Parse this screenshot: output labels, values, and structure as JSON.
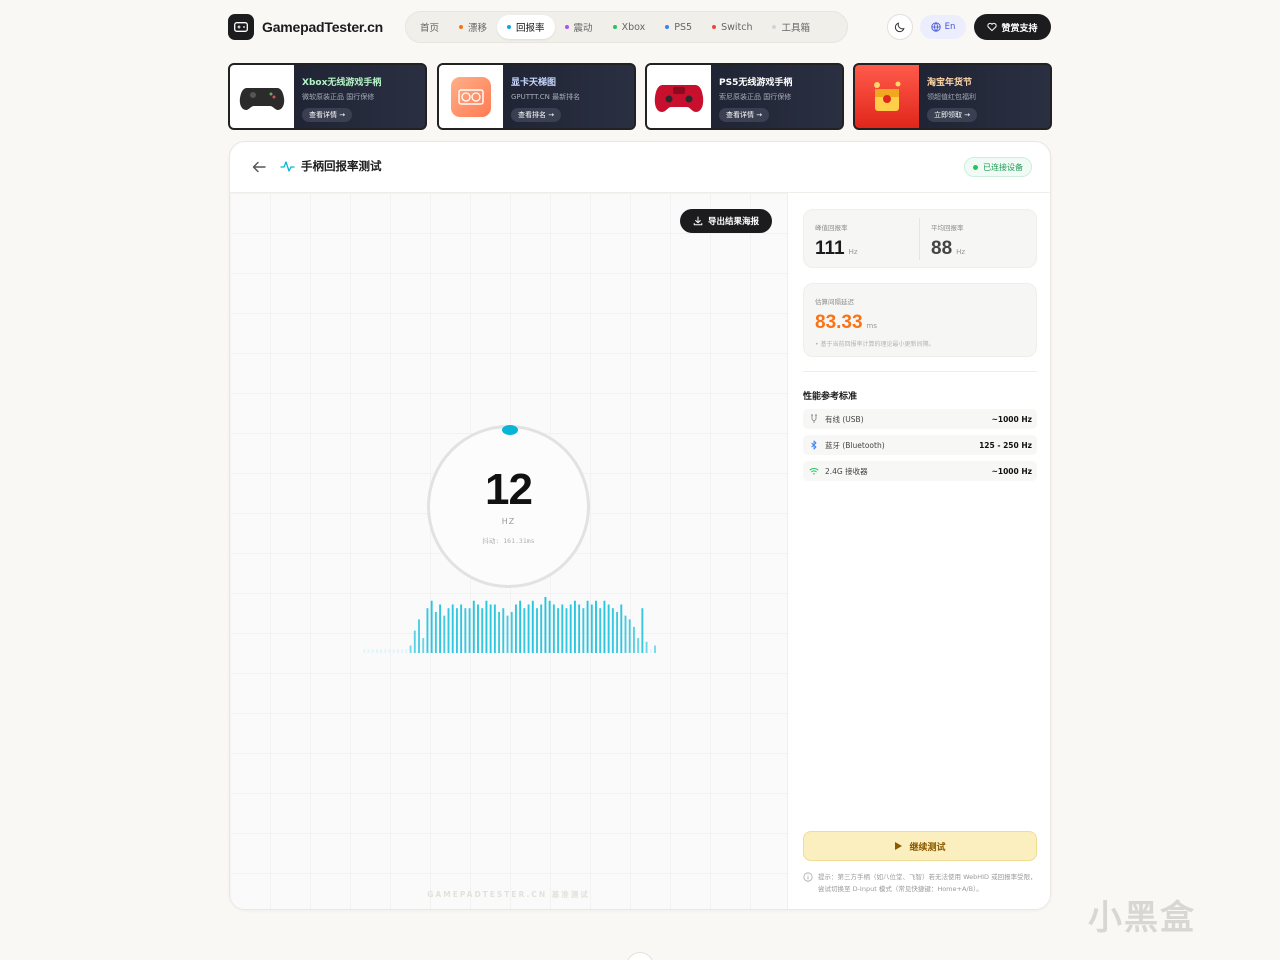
{
  "brand": {
    "name": "GamepadTester.cn"
  },
  "nav": {
    "items": [
      {
        "label": "首页",
        "dot": ""
      },
      {
        "label": "漂移",
        "dot": "#f97316"
      },
      {
        "label": "回报率",
        "dot": "#0ea5e9",
        "active": true
      },
      {
        "label": "震动",
        "dot": "#a855f7"
      },
      {
        "label": "Xbox",
        "dot": "#22c55e"
      },
      {
        "label": "PS5",
        "dot": "#3b82f6"
      },
      {
        "label": "Switch",
        "dot": "#ef4444"
      },
      {
        "label": "工具箱",
        "dot": "#cbd5e1"
      }
    ]
  },
  "header": {
    "lang_label": "En",
    "support_label": "赞赏支持"
  },
  "banners": [
    {
      "title": "Xbox无线游戏手柄",
      "subtitle": "微软原装正品 国行保修",
      "cta": "查看详情 →",
      "title_color": "#b6f5c8"
    },
    {
      "title": "显卡天梯图",
      "subtitle": "GPUTTT.CN 最新排名",
      "cta": "查看排名 →",
      "title_color": "#c9d8ff"
    },
    {
      "title": "PS5无线游戏手柄",
      "subtitle": "索尼原装正品 国行保修",
      "cta": "查看详情 →",
      "title_color": "#ffffff"
    },
    {
      "title": "淘宝年货节",
      "subtitle": "领超值红包福利",
      "cta": "立即领取 →",
      "title_color": "#ffd6a6"
    }
  ],
  "page": {
    "title": "手柄回报率测试",
    "status": "已连接设备",
    "export_label": "导出结果海报",
    "watermark": "GAMEPADTESTER.CN 基准测试"
  },
  "gauge": {
    "value": "12",
    "unit": "HZ",
    "jitter": "抖动: 161.31ms",
    "accent": "#06b6d4"
  },
  "chart_data": {
    "type": "bar",
    "values": [
      1,
      1,
      1,
      1,
      1,
      1,
      1,
      1,
      1,
      1,
      1,
      2,
      6,
      9,
      4,
      12,
      14,
      11,
      13,
      10,
      12,
      13,
      12,
      13,
      12,
      12,
      14,
      13,
      12,
      14,
      13,
      13,
      11,
      12,
      10,
      11,
      13,
      14,
      12,
      13,
      14,
      12,
      13,
      15,
      14,
      13,
      12,
      13,
      12,
      13,
      14,
      13,
      12,
      14,
      13,
      14,
      12,
      14,
      13,
      12,
      11,
      13,
      10,
      9,
      7,
      4,
      12,
      3,
      1,
      2
    ],
    "color": "#22c3dd"
  },
  "stats": {
    "peak_label": "峰值回报率",
    "peak_value": "111",
    "peak_unit": "Hz",
    "avg_label": "平均回报率",
    "avg_value": "88",
    "avg_unit": "Hz",
    "latency_label": "估算间隔延迟",
    "latency_value": "83.33",
    "latency_unit": "ms",
    "latency_note": "• 基于当前回报率计算的理论最小更新间隔。",
    "latency_color": "#f97316"
  },
  "reference": {
    "title": "性能参考标准",
    "rows": [
      {
        "label": "有线 (USB)",
        "value": "~1000 Hz",
        "icon": "usb-icon"
      },
      {
        "label": "蓝牙 (Bluetooth)",
        "value": "125 - 250 Hz",
        "icon": "bluetooth-icon"
      },
      {
        "label": "2.4G 接收器",
        "value": "~1000 Hz",
        "icon": "wifi-icon"
      }
    ]
  },
  "actions": {
    "continue_label": "继续测试",
    "tip": "提示：第三方手柄（如八位堂、飞智）若无法使用 WebHID 或回报率受限，尝试切换至 D-Input 模式（常见快捷键：Home+A/B）。"
  },
  "site_mark": "小黑盒"
}
